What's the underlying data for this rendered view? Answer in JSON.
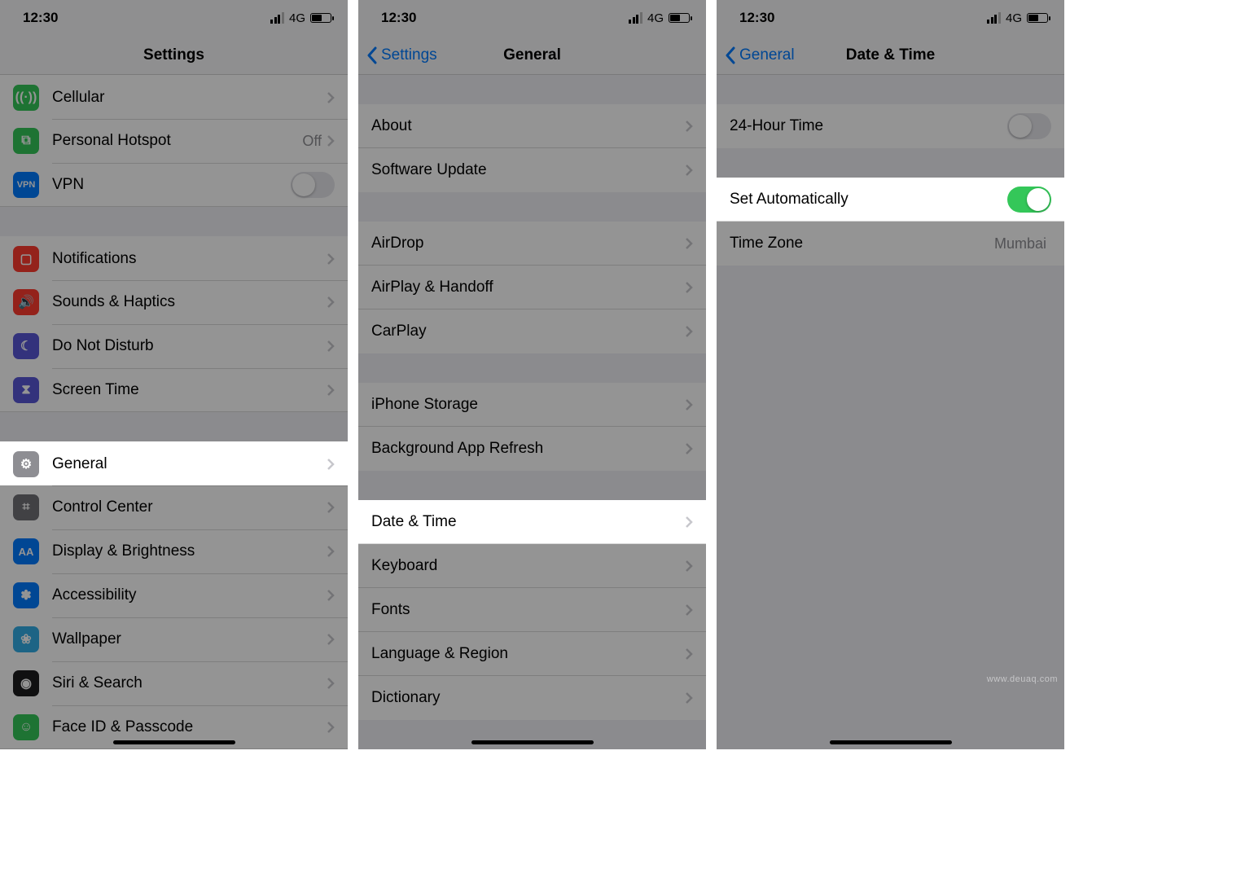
{
  "status": {
    "time": "12:30",
    "net": "4G"
  },
  "phone1": {
    "title": "Settings",
    "groups": [
      [
        {
          "label": "Cellular",
          "icon": "antenna-icon",
          "color": "bg-green"
        },
        {
          "label": "Personal Hotspot",
          "icon": "link-icon",
          "color": "bg-green",
          "value": "Off"
        },
        {
          "label": "VPN",
          "icon": "vpn-icon",
          "color": "bg-blue",
          "toggle": false
        }
      ],
      [
        {
          "label": "Notifications",
          "icon": "notifications-icon",
          "color": "bg-red"
        },
        {
          "label": "Sounds & Haptics",
          "icon": "sounds-icon",
          "color": "bg-red"
        },
        {
          "label": "Do Not Disturb",
          "icon": "moon-icon",
          "color": "bg-purple"
        },
        {
          "label": "Screen Time",
          "icon": "hourglass-icon",
          "color": "bg-purple"
        }
      ],
      [
        {
          "label": "General",
          "icon": "gear-icon",
          "color": "bg-gray",
          "highlight": true
        },
        {
          "label": "Control Center",
          "icon": "switches-icon",
          "color": "bg-gray2"
        },
        {
          "label": "Display & Brightness",
          "icon": "textsize-icon",
          "color": "bg-blue"
        },
        {
          "label": "Accessibility",
          "icon": "accessibility-icon",
          "color": "bg-blue"
        },
        {
          "label": "Wallpaper",
          "icon": "wallpaper-icon",
          "color": "bg-cyan"
        },
        {
          "label": "Siri & Search",
          "icon": "siri-icon",
          "color": "bg-dark"
        },
        {
          "label": "Face ID & Passcode",
          "icon": "faceid-icon",
          "color": "bg-green"
        }
      ]
    ]
  },
  "phone2": {
    "back": "Settings",
    "title": "General",
    "groups": [
      [
        {
          "label": "About"
        },
        {
          "label": "Software Update"
        }
      ],
      [
        {
          "label": "AirDrop"
        },
        {
          "label": "AirPlay & Handoff"
        },
        {
          "label": "CarPlay"
        }
      ],
      [
        {
          "label": "iPhone Storage"
        },
        {
          "label": "Background App Refresh"
        }
      ],
      [
        {
          "label": "Date & Time",
          "highlight": true
        },
        {
          "label": "Keyboard"
        },
        {
          "label": "Fonts"
        },
        {
          "label": "Language & Region"
        },
        {
          "label": "Dictionary"
        }
      ]
    ]
  },
  "phone3": {
    "back": "General",
    "title": "Date & Time",
    "rows": {
      "twentyFour": {
        "label": "24-Hour Time",
        "on": false
      },
      "setAuto": {
        "label": "Set Automatically",
        "on": true,
        "highlight": true
      },
      "timeZone": {
        "label": "Time Zone",
        "value": "Mumbai"
      }
    }
  },
  "watermark": "www.deuaq.com"
}
